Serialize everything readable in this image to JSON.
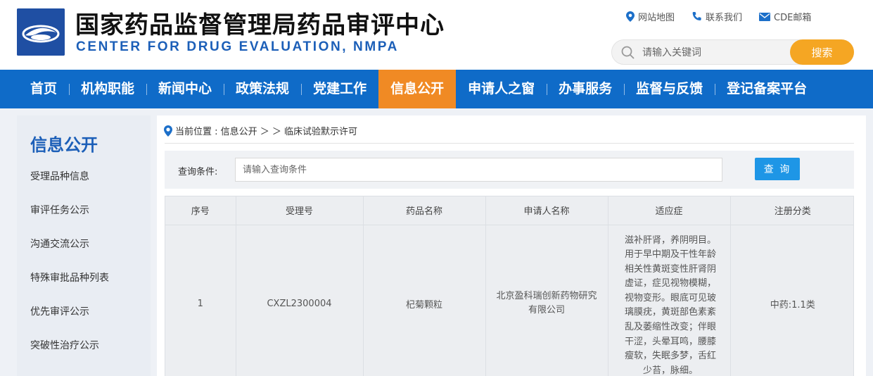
{
  "header": {
    "title": "国家药品监督管理局药品审评中心",
    "subtitle": "CENTER FOR DRUG EVALUATION, NMPA",
    "links": [
      {
        "label": "网站地图",
        "icon": "location-pin-icon"
      },
      {
        "label": "联系我们",
        "icon": "phone-icon"
      },
      {
        "label": "CDE邮箱",
        "icon": "mail-icon"
      }
    ],
    "search": {
      "placeholder": "请输入关键词",
      "button": "搜索"
    }
  },
  "nav": {
    "items": [
      "首页",
      "机构职能",
      "新闻中心",
      "政策法规",
      "党建工作",
      "信息公开",
      "申请人之窗",
      "办事服务",
      "监督与反馈",
      "登记备案平台"
    ],
    "active_index": 5
  },
  "sidebar": {
    "title": "信息公开",
    "items": [
      "受理品种信息",
      "审评任务公示",
      "沟通交流公示",
      "特殊审批品种列表",
      "优先审评公示",
      "突破性治疗公示"
    ]
  },
  "breadcrumb": {
    "text": "当前位置 : 信息公开 ＞ ＞ 临床试验默示许可"
  },
  "query": {
    "label": "查询条件:",
    "placeholder": "请输入查询条件",
    "button": "查 询"
  },
  "table": {
    "headers": [
      "序号",
      "受理号",
      "药品名称",
      "申请人名称",
      "适应症",
      "注册分类"
    ],
    "rows": [
      {
        "index": "1",
        "acceptance_no": "CXZL2300004",
        "drug_name": "杞菊颗粒",
        "applicant": "北京盈科瑞创新药物研究有限公司",
        "indication_lines": [
          "滋补肝肾，养阴明目。",
          "用于早中期及干性年龄",
          "相关性黄斑变性肝肾阴",
          "虚证，症见视物模糊，",
          "视物变形。眼底可见玻",
          "璃膜疣，黄斑部色素紊",
          "乱及萎缩性改变；伴眼",
          "干涩，头晕耳鸣，腰膝",
          "瘦软，失眠多梦，舌红",
          "少苔，脉细。"
        ],
        "category": "中药:1.1类"
      }
    ]
  },
  "colors": {
    "brand_blue": "#0f6bc8",
    "accent_orange": "#f08a24",
    "search_button": "#f5a623",
    "query_button": "#1e96e6"
  }
}
